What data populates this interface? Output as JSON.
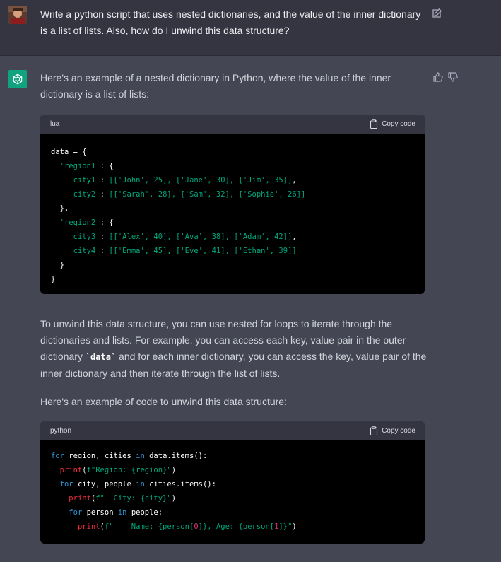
{
  "user_message": {
    "text": "Write a python script that uses nested dictionaries, and the value of the inner dictionary is a list of lists. Also, how do I unwind this data structure?"
  },
  "assistant": {
    "intro": "Here's an example of a nested dictionary in Python, where the value of the inner dictionary is a list of lists:",
    "block1": {
      "language": "lua",
      "copy_label": "Copy code"
    },
    "para2_before": "To unwind this data structure, you can use nested for loops to iterate through the dictionaries and lists. For example, you can access each key, value pair in the outer dictionary ",
    "para2_code": "`data`",
    "para2_after": " and for each inner dictionary, you can access the key, value pair of the inner dictionary and then iterate through the list of lists.",
    "para3": "Here's an example of code to unwind this data structure:",
    "block2": {
      "language": "python",
      "copy_label": "Copy code"
    }
  },
  "code1": {
    "l1": "data = {",
    "l2": "'region1'",
    "l3_key": "'city1'",
    "l3_vals": "[['John', 25], ['Jane', 30], ['Jim', 35]]",
    "l4_key": "'city2'",
    "l4_vals": "[['Sarah', 28], ['Sam', 32], ['Sophie', 26]]",
    "l6": "'region2'",
    "l7_key": "'city3'",
    "l7_vals": "[['Alex', 40], ['Ava', 38], ['Adam', 42]]",
    "l8_key": "'city4'",
    "l8_vals": "[['Emma', 45], ['Eve', 41], ['Ethan', 39]]"
  },
  "code2": {
    "l1_for": "for",
    "l1_a": " region, cities ",
    "l1_in": "in",
    "l1_b": " data.items():",
    "l2_print": "print",
    "l2_str": "f\"Region: {region}\"",
    "l3_for": "for",
    "l3_a": " city, people ",
    "l3_in": "in",
    "l3_b": " cities.items():",
    "l4_print": "print",
    "l4_str": "f\"  City: {city}\"",
    "l5_for": "for",
    "l5_a": " person ",
    "l5_in": "in",
    "l5_b": " people:",
    "l6_print": "print",
    "l6_s1": "f\"    Name: {person[",
    "l6_n1": "0",
    "l6_s2": "]}, Age: {person[",
    "l6_n2": "1",
    "l6_s3": "]}\""
  },
  "colors": {
    "user_bg": "#343541",
    "assistant_bg": "#444654",
    "brand": "#10a37f",
    "code_bg": "#000000"
  },
  "icons": [
    "user-avatar",
    "edit-icon",
    "openai-logo-icon",
    "thumbs-up-icon",
    "thumbs-down-icon",
    "clipboard-icon"
  ]
}
